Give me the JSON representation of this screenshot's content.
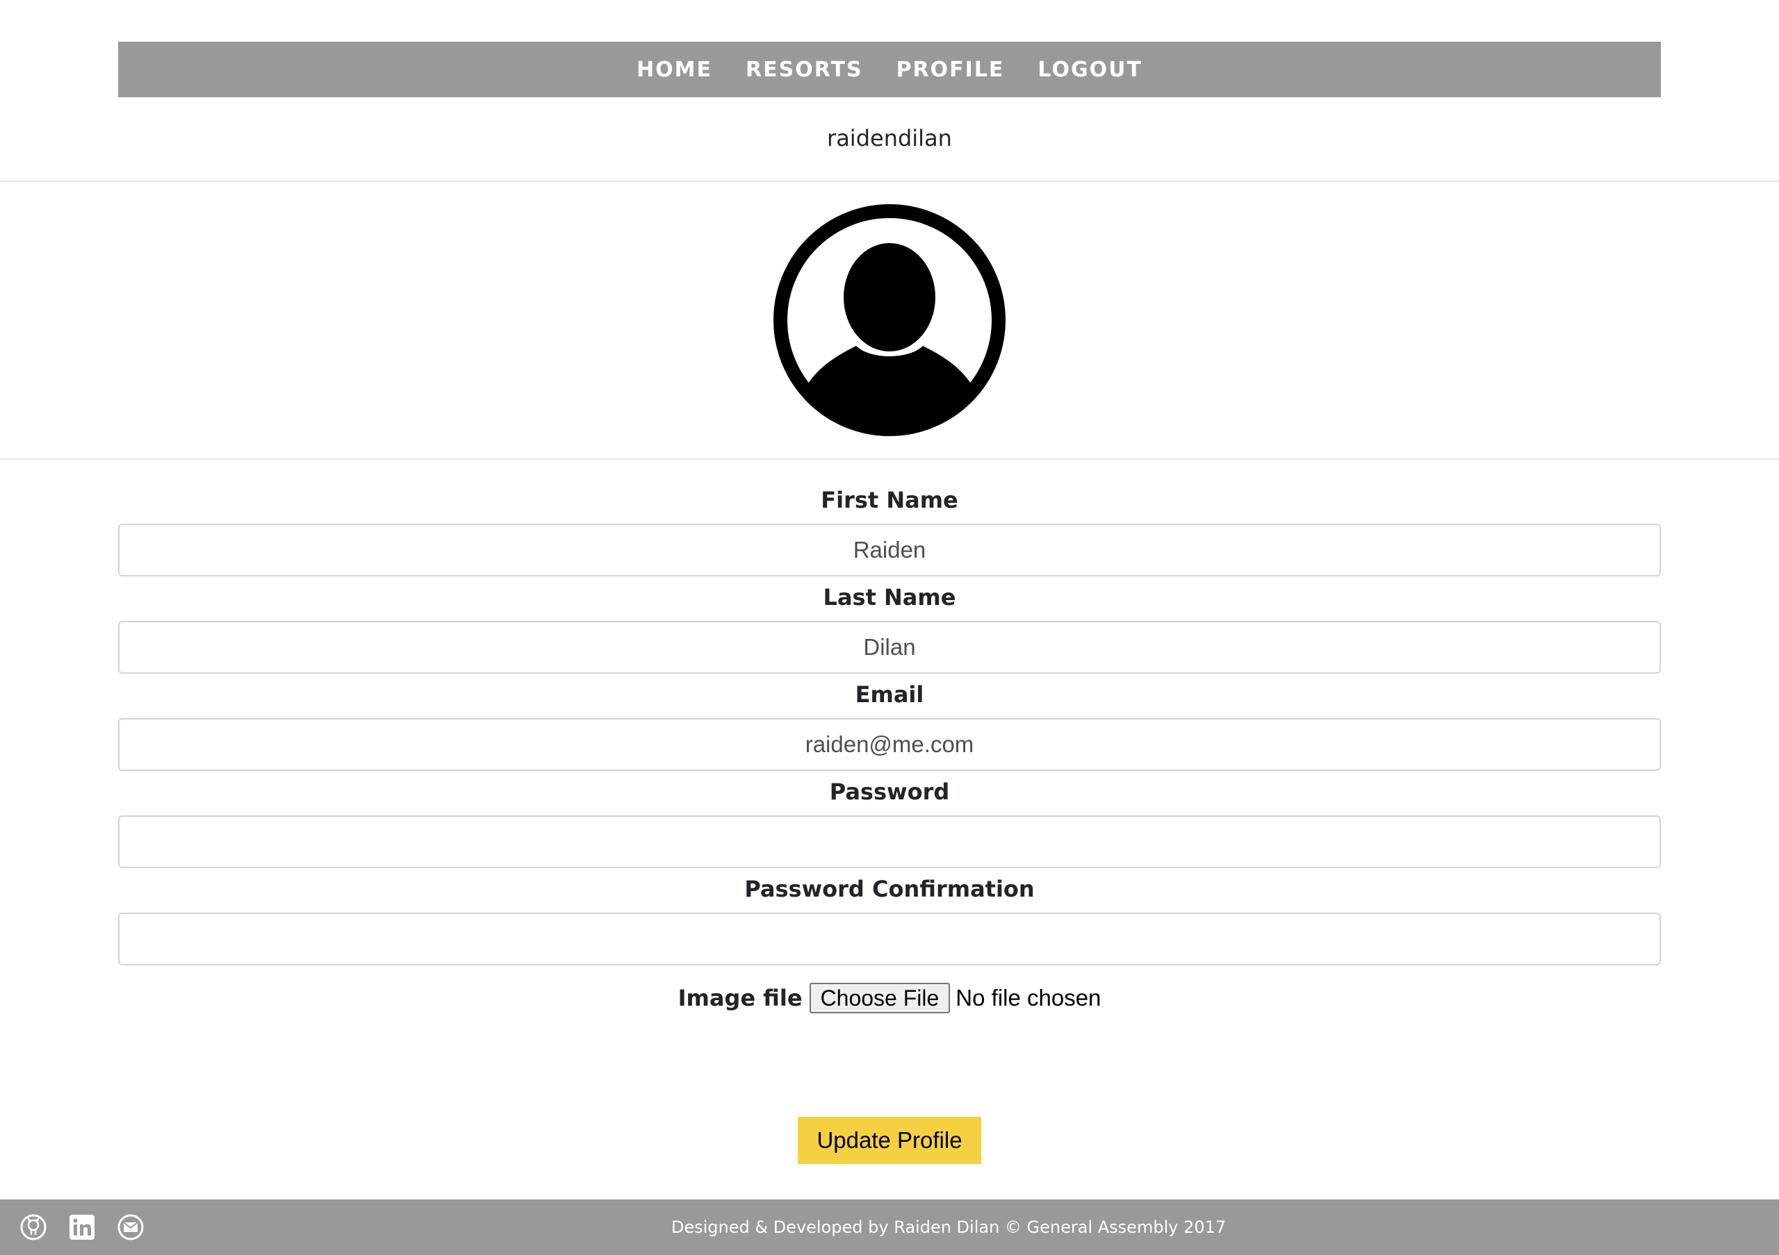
{
  "nav": {
    "items": [
      {
        "label": "HOME"
      },
      {
        "label": "RESORTS"
      },
      {
        "label": "PROFILE"
      },
      {
        "label": "LOGOUT"
      }
    ]
  },
  "profile": {
    "username": "raidendilan",
    "avatar_icon": "user-avatar-icon"
  },
  "form": {
    "first_name_label": "First Name",
    "first_name_value": "Raiden",
    "last_name_label": "Last Name",
    "last_name_value": "Dilan",
    "email_label": "Email",
    "email_value": "raiden@me.com",
    "password_label": "Password",
    "password_value": "",
    "password_confirmation_label": "Password Confirmation",
    "password_confirmation_value": "",
    "image_file_label": "Image file",
    "choose_file_label": "Choose File",
    "file_status": "No file chosen",
    "submit_label": "Update Profile"
  },
  "footer": {
    "text": "Designed & Developed by Raiden Dilan © General Assembly 2017",
    "icons": [
      "github-icon",
      "linkedin-icon",
      "email-icon"
    ]
  },
  "colors": {
    "nav_background": "#999999",
    "footer_background": "#999999",
    "submit_background": "#f5d142",
    "text": "#212529"
  }
}
